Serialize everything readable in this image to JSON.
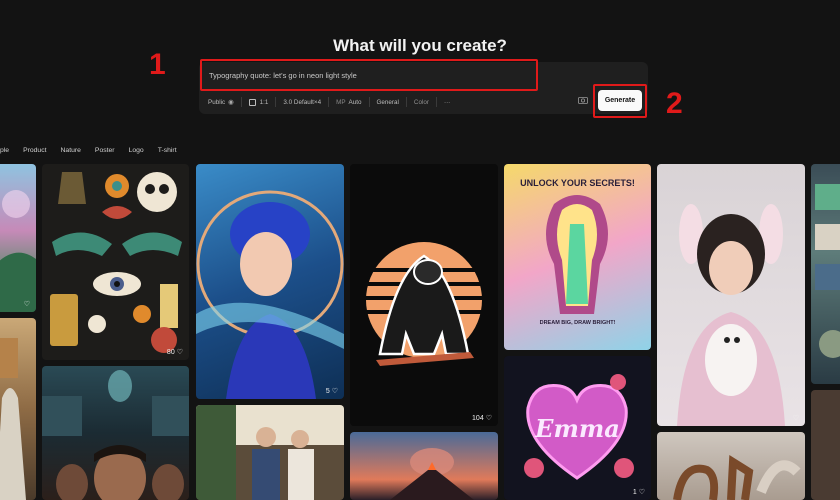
{
  "heading": "What will you create?",
  "prompt": {
    "value": "Typography quote: let's go  in neon light style"
  },
  "toolbar": {
    "visibility": "Public",
    "aspect": "1:1",
    "model": "3.0 Default",
    "model_count": "×4",
    "mp_label": "MP",
    "mp_value": "Auto",
    "style": "General",
    "color": "Color",
    "more": "···"
  },
  "generate_label": "Generate",
  "steps": {
    "one": "1",
    "two": "2"
  },
  "categories": [
    "ple",
    "Product",
    "Nature",
    "Poster",
    "Logo",
    "T-shirt"
  ],
  "gallery": {
    "tattoo_likes": "80",
    "blue_woman_likes": "5",
    "gorilla_likes": "104",
    "emma_likes": "1",
    "poster_text_top": "UNLOCK YOUR SECRETS!",
    "poster_text_bottom": "DREAM BIG, DRAW BRIGHT!",
    "emma_text": "Emma"
  },
  "colors": {
    "accent_red": "#e01a1a",
    "background": "#131313",
    "panel": "#1f1f1f"
  }
}
